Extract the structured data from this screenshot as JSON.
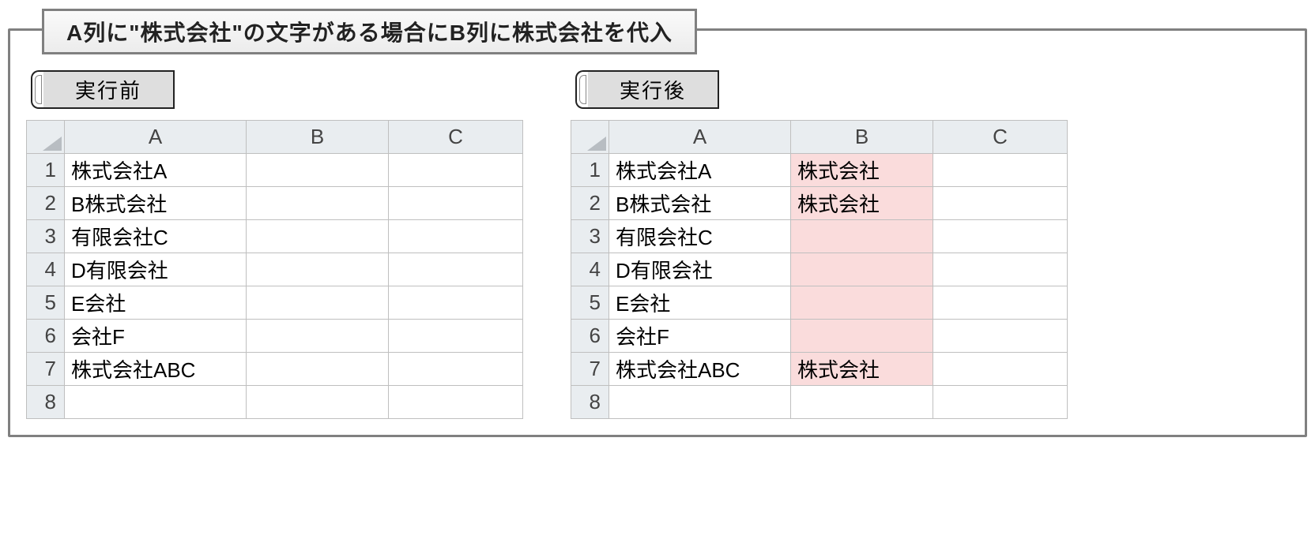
{
  "title": "A列に\"株式会社\"の文字がある場合にB列に株式会社を代入",
  "before": {
    "label": "実行前",
    "columns": [
      "A",
      "B",
      "C"
    ],
    "rows": [
      {
        "n": "1",
        "A": "株式会社A",
        "B": "",
        "C": ""
      },
      {
        "n": "2",
        "A": "B株式会社",
        "B": "",
        "C": ""
      },
      {
        "n": "3",
        "A": "有限会社C",
        "B": "",
        "C": ""
      },
      {
        "n": "4",
        "A": "D有限会社",
        "B": "",
        "C": ""
      },
      {
        "n": "5",
        "A": "E会社",
        "B": "",
        "C": ""
      },
      {
        "n": "6",
        "A": "会社F",
        "B": "",
        "C": ""
      },
      {
        "n": "7",
        "A": "株式会社ABC",
        "B": "",
        "C": ""
      },
      {
        "n": "8",
        "A": "",
        "B": "",
        "C": ""
      }
    ]
  },
  "after": {
    "label": "実行後",
    "columns": [
      "A",
      "B",
      "C"
    ],
    "rows": [
      {
        "n": "1",
        "A": "株式会社A",
        "B": "株式会社",
        "C": "",
        "Bhl": true
      },
      {
        "n": "2",
        "A": "B株式会社",
        "B": "株式会社",
        "C": "",
        "Bhl": true
      },
      {
        "n": "3",
        "A": "有限会社C",
        "B": "",
        "C": "",
        "Bhl": true
      },
      {
        "n": "4",
        "A": "D有限会社",
        "B": "",
        "C": "",
        "Bhl": true
      },
      {
        "n": "5",
        "A": "E会社",
        "B": "",
        "C": "",
        "Bhl": true
      },
      {
        "n": "6",
        "A": "会社F",
        "B": "",
        "C": "",
        "Bhl": true
      },
      {
        "n": "7",
        "A": "株式会社ABC",
        "B": "株式会社",
        "C": "",
        "Bhl": true
      },
      {
        "n": "8",
        "A": "",
        "B": "",
        "C": ""
      }
    ]
  }
}
